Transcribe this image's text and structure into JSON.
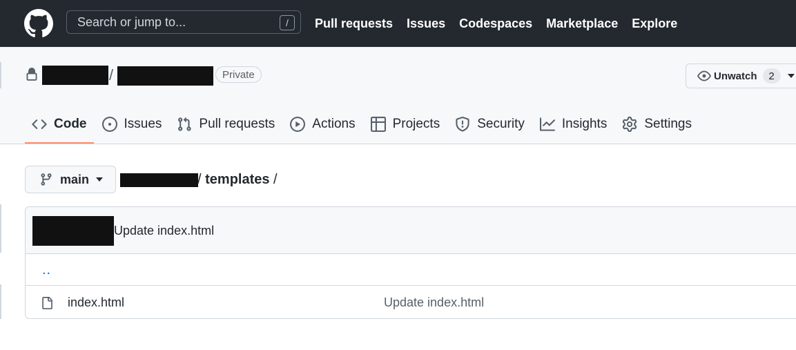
{
  "header": {
    "search_placeholder": "Search or jump to...",
    "search_shortcut": "/",
    "nav": [
      "Pull requests",
      "Issues",
      "Codespaces",
      "Marketplace",
      "Explore"
    ]
  },
  "repo": {
    "separator": "/",
    "visibility": "Private",
    "watch_label": "Unwatch",
    "watch_count": "2"
  },
  "tabs": [
    {
      "label": "Code",
      "icon": "code-icon",
      "active": true
    },
    {
      "label": "Issues",
      "icon": "issue-icon"
    },
    {
      "label": "Pull requests",
      "icon": "pull-request-icon"
    },
    {
      "label": "Actions",
      "icon": "play-icon"
    },
    {
      "label": "Projects",
      "icon": "table-icon"
    },
    {
      "label": "Security",
      "icon": "shield-icon"
    },
    {
      "label": "Insights",
      "icon": "graph-icon"
    },
    {
      "label": "Settings",
      "icon": "gear-icon"
    }
  ],
  "branch": {
    "name": "main"
  },
  "breadcrumb": {
    "path_prefix": "/ ",
    "folder": "templates",
    "path_suffix": " /"
  },
  "files": {
    "latest_commit_message": "Update index.html",
    "parent_link": "..",
    "rows": [
      {
        "name": "index.html",
        "commit_message": "Update index.html"
      }
    ]
  },
  "colors": {
    "header_bg": "#24292f",
    "tab_underline": "#fd8c73",
    "link": "#0969da"
  }
}
